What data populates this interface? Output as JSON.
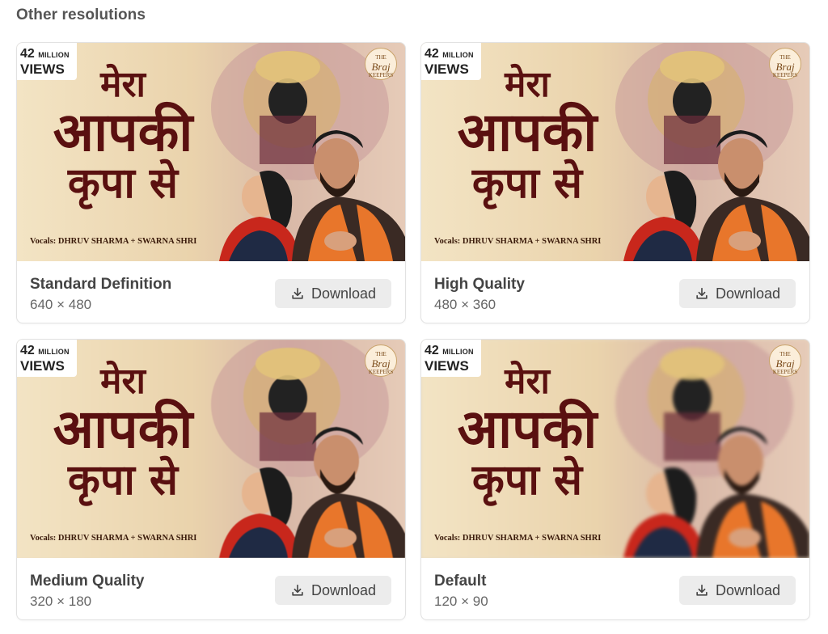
{
  "section": {
    "title": "Other resolutions"
  },
  "thumbnail": {
    "views_number": "42",
    "views_million": "MILLION",
    "views_word": "VIEWS",
    "title_line1": "मेरा",
    "title_line2": "आपकी",
    "title_line3": "कृपा से",
    "vocals": "Vocals: DHRUV SHARMA + SWARNA SHRI",
    "logo_top": "THE",
    "logo_main": "Braj",
    "logo_bottom": "KEEPERS"
  },
  "cards": [
    {
      "label": "Standard Definition",
      "size": "640 × 480",
      "button": "Download"
    },
    {
      "label": "High Quality",
      "size": "480 × 360",
      "button": "Download"
    },
    {
      "label": "Medium Quality",
      "size": "320 × 180",
      "button": "Download"
    },
    {
      "label": "Default",
      "size": "120 × 90",
      "button": "Download"
    }
  ],
  "icons": {
    "download": "download-icon"
  },
  "colors": {
    "button_bg": "#ececec",
    "title_red": "#5a1010",
    "saffron": "#e8762b"
  }
}
